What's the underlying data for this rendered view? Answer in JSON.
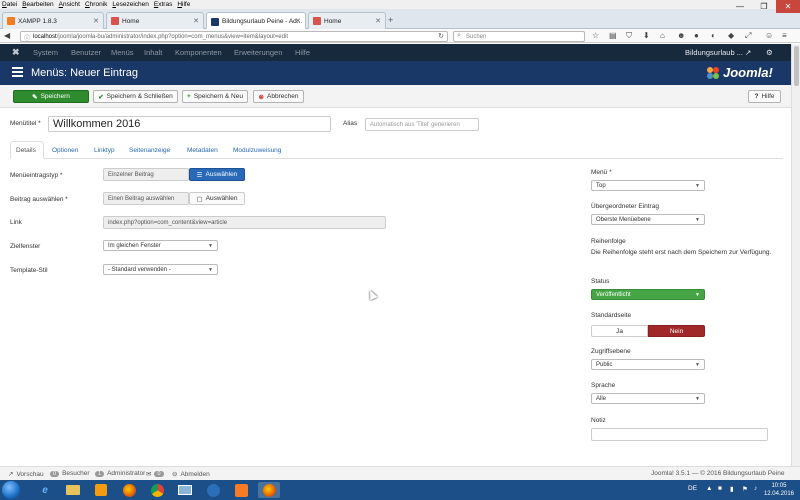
{
  "browser": {
    "menu": [
      "Datei",
      "Bearbeiten",
      "Ansicht",
      "Chronik",
      "Lesezeichen",
      "Extras",
      "Hilfe"
    ],
    "tabs": [
      {
        "label": "XAMPP 1.8.3",
        "active": false
      },
      {
        "label": "Home",
        "active": false
      },
      {
        "label": "Bildungsurlaub Peine - Ad...",
        "active": true
      },
      {
        "label": "Home",
        "active": false
      }
    ],
    "new_tab": "+",
    "url_host": "localhost",
    "url_path": "/joomla/joomla-bu/administrator/index.php?option=com_menus&view=item&layout=edit",
    "search_placeholder": "Suchen",
    "window_controls": [
      "—",
      "❐",
      "✕"
    ]
  },
  "joomla_nav": {
    "logo_glyph": "✖",
    "items": [
      "System",
      "Benutzer",
      "Menüs",
      "Inhalt",
      "Komponenten",
      "Erweiterungen",
      "Hilfe"
    ],
    "site_name": "Bildungsurlaub ...",
    "site_glyph": "↗",
    "user_glyph": "⚙"
  },
  "title_bar": {
    "title": "Menüs: Neuer Eintrag",
    "logo_text": "Joomla!"
  },
  "toolbar": {
    "save": "Speichern",
    "save_close": "Speichern & Schließen",
    "save_new": "Speichern & Neu",
    "cancel": "Abbrechen",
    "help": "Hilfe",
    "save_icon": "✎",
    "save_close_icon": "✔",
    "save_new_icon": "+",
    "cancel_icon": "⊗",
    "help_icon": "?"
  },
  "form": {
    "menu_title_label": "Menütitel *",
    "menu_title_value": "Willkommen 2016",
    "alias_label": "Alias",
    "alias_placeholder": "Automatisch aus 'Titel' generieren",
    "tabs": [
      "Details",
      "Optionen",
      "Linktyp",
      "Seitenanzeige",
      "Metadaten",
      "Modulzuweisung"
    ],
    "menu_item_type_label": "Menüeintragstyp *",
    "menu_item_type_value": "Einzelner Beitrag",
    "select_button": "Auswählen",
    "select_button_icon": "☰",
    "select_article_label": "Beitrag auswählen *",
    "select_article_value": "Einen Beitrag auswählen",
    "select_article_button": "Auswählen",
    "select_article_icon": "▢",
    "link_label": "Link",
    "link_value": "index.php?option=com_content&view=article",
    "target_window_label": "Zielfenster",
    "target_window_value": "Im gleichen Fenster",
    "template_style_label": "Template-Stil",
    "template_style_value": "- Standard verwenden -",
    "select_arrow": "▼"
  },
  "sidebar": {
    "menu_label": "Menü *",
    "menu_value": "Top",
    "parent_label": "Übergeordneter Eintrag",
    "parent_value": "Oberste Menüebene",
    "ordering_label": "Reihenfolge",
    "ordering_note": "Die Reihenfolge steht erst nach dem Speichern zur Verfügung.",
    "status_label": "Status",
    "status_value": "Veröffentlicht",
    "default_page_label": "Standardseite",
    "default_yes": "Ja",
    "default_no": "Nein",
    "access_label": "Zugriffsebene",
    "access_value": "Public",
    "language_label": "Sprache",
    "language_value": "Alle",
    "note_label": "Notiz"
  },
  "footer": {
    "preview": "Vorschau",
    "visitors_count": "0",
    "visitors_label": "Besucher",
    "admin_count": "1",
    "admin_label": "Administrator",
    "messages_count": "0",
    "logout": "Abmelden",
    "copyright": "Joomla! 3.5.1 — © 2016 Bildungsurlaub Peine"
  },
  "taskbar": {
    "language": "DE",
    "time": "10:05",
    "date": "12.04.2016"
  }
}
